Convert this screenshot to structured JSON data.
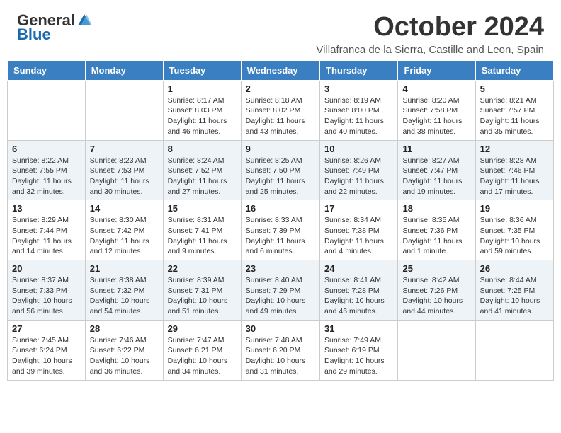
{
  "header": {
    "logo_general": "General",
    "logo_blue": "Blue",
    "month_title": "October 2024",
    "subtitle": "Villafranca de la Sierra, Castille and Leon, Spain"
  },
  "weekdays": [
    "Sunday",
    "Monday",
    "Tuesday",
    "Wednesday",
    "Thursday",
    "Friday",
    "Saturday"
  ],
  "weeks": [
    [
      {
        "day": "",
        "info": ""
      },
      {
        "day": "",
        "info": ""
      },
      {
        "day": "1",
        "info": "Sunrise: 8:17 AM\nSunset: 8:03 PM\nDaylight: 11 hours and 46 minutes."
      },
      {
        "day": "2",
        "info": "Sunrise: 8:18 AM\nSunset: 8:02 PM\nDaylight: 11 hours and 43 minutes."
      },
      {
        "day": "3",
        "info": "Sunrise: 8:19 AM\nSunset: 8:00 PM\nDaylight: 11 hours and 40 minutes."
      },
      {
        "day": "4",
        "info": "Sunrise: 8:20 AM\nSunset: 7:58 PM\nDaylight: 11 hours and 38 minutes."
      },
      {
        "day": "5",
        "info": "Sunrise: 8:21 AM\nSunset: 7:57 PM\nDaylight: 11 hours and 35 minutes."
      }
    ],
    [
      {
        "day": "6",
        "info": "Sunrise: 8:22 AM\nSunset: 7:55 PM\nDaylight: 11 hours and 32 minutes."
      },
      {
        "day": "7",
        "info": "Sunrise: 8:23 AM\nSunset: 7:53 PM\nDaylight: 11 hours and 30 minutes."
      },
      {
        "day": "8",
        "info": "Sunrise: 8:24 AM\nSunset: 7:52 PM\nDaylight: 11 hours and 27 minutes."
      },
      {
        "day": "9",
        "info": "Sunrise: 8:25 AM\nSunset: 7:50 PM\nDaylight: 11 hours and 25 minutes."
      },
      {
        "day": "10",
        "info": "Sunrise: 8:26 AM\nSunset: 7:49 PM\nDaylight: 11 hours and 22 minutes."
      },
      {
        "day": "11",
        "info": "Sunrise: 8:27 AM\nSunset: 7:47 PM\nDaylight: 11 hours and 19 minutes."
      },
      {
        "day": "12",
        "info": "Sunrise: 8:28 AM\nSunset: 7:46 PM\nDaylight: 11 hours and 17 minutes."
      }
    ],
    [
      {
        "day": "13",
        "info": "Sunrise: 8:29 AM\nSunset: 7:44 PM\nDaylight: 11 hours and 14 minutes."
      },
      {
        "day": "14",
        "info": "Sunrise: 8:30 AM\nSunset: 7:42 PM\nDaylight: 11 hours and 12 minutes."
      },
      {
        "day": "15",
        "info": "Sunrise: 8:31 AM\nSunset: 7:41 PM\nDaylight: 11 hours and 9 minutes."
      },
      {
        "day": "16",
        "info": "Sunrise: 8:33 AM\nSunset: 7:39 PM\nDaylight: 11 hours and 6 minutes."
      },
      {
        "day": "17",
        "info": "Sunrise: 8:34 AM\nSunset: 7:38 PM\nDaylight: 11 hours and 4 minutes."
      },
      {
        "day": "18",
        "info": "Sunrise: 8:35 AM\nSunset: 7:36 PM\nDaylight: 11 hours and 1 minute."
      },
      {
        "day": "19",
        "info": "Sunrise: 8:36 AM\nSunset: 7:35 PM\nDaylight: 10 hours and 59 minutes."
      }
    ],
    [
      {
        "day": "20",
        "info": "Sunrise: 8:37 AM\nSunset: 7:33 PM\nDaylight: 10 hours and 56 minutes."
      },
      {
        "day": "21",
        "info": "Sunrise: 8:38 AM\nSunset: 7:32 PM\nDaylight: 10 hours and 54 minutes."
      },
      {
        "day": "22",
        "info": "Sunrise: 8:39 AM\nSunset: 7:31 PM\nDaylight: 10 hours and 51 minutes."
      },
      {
        "day": "23",
        "info": "Sunrise: 8:40 AM\nSunset: 7:29 PM\nDaylight: 10 hours and 49 minutes."
      },
      {
        "day": "24",
        "info": "Sunrise: 8:41 AM\nSunset: 7:28 PM\nDaylight: 10 hours and 46 minutes."
      },
      {
        "day": "25",
        "info": "Sunrise: 8:42 AM\nSunset: 7:26 PM\nDaylight: 10 hours and 44 minutes."
      },
      {
        "day": "26",
        "info": "Sunrise: 8:44 AM\nSunset: 7:25 PM\nDaylight: 10 hours and 41 minutes."
      }
    ],
    [
      {
        "day": "27",
        "info": "Sunrise: 7:45 AM\nSunset: 6:24 PM\nDaylight: 10 hours and 39 minutes."
      },
      {
        "day": "28",
        "info": "Sunrise: 7:46 AM\nSunset: 6:22 PM\nDaylight: 10 hours and 36 minutes."
      },
      {
        "day": "29",
        "info": "Sunrise: 7:47 AM\nSunset: 6:21 PM\nDaylight: 10 hours and 34 minutes."
      },
      {
        "day": "30",
        "info": "Sunrise: 7:48 AM\nSunset: 6:20 PM\nDaylight: 10 hours and 31 minutes."
      },
      {
        "day": "31",
        "info": "Sunrise: 7:49 AM\nSunset: 6:19 PM\nDaylight: 10 hours and 29 minutes."
      },
      {
        "day": "",
        "info": ""
      },
      {
        "day": "",
        "info": ""
      }
    ]
  ]
}
